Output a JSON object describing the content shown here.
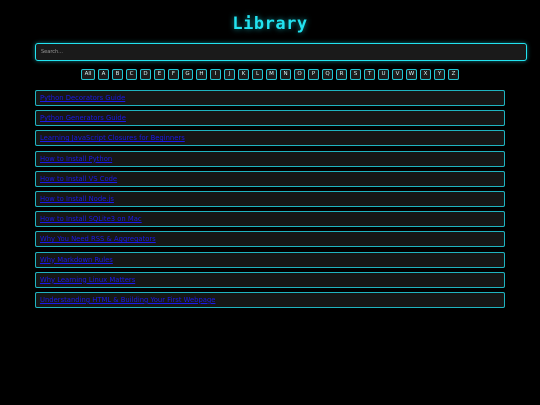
{
  "header": {
    "title": "Library"
  },
  "search": {
    "placeholder": "Search..."
  },
  "alphabet": {
    "letters": [
      "All",
      "A",
      "B",
      "C",
      "D",
      "E",
      "F",
      "G",
      "H",
      "I",
      "J",
      "K",
      "L",
      "M",
      "N",
      "O",
      "P",
      "Q",
      "R",
      "S",
      "T",
      "U",
      "V",
      "W",
      "X",
      "Y",
      "Z"
    ]
  },
  "articles": {
    "items": [
      "Python Decorators Guide",
      "Python Generators Guide",
      "Learning JavaScript Closures for Beginners",
      "How to Install Python",
      "How to Install VS Code",
      "How to Install Node.js",
      "How to Install SQLite3 on Mac",
      "Why You Need RSS & Aggregators",
      "Why Markdown Rules",
      "Why Learning Linux Matters",
      "Understanding HTML & Building Your First Webpage"
    ]
  },
  "colors": {
    "background": "#000000",
    "accent": "#22e3f0",
    "link": "#1a1ae6",
    "panel": "#161616"
  }
}
